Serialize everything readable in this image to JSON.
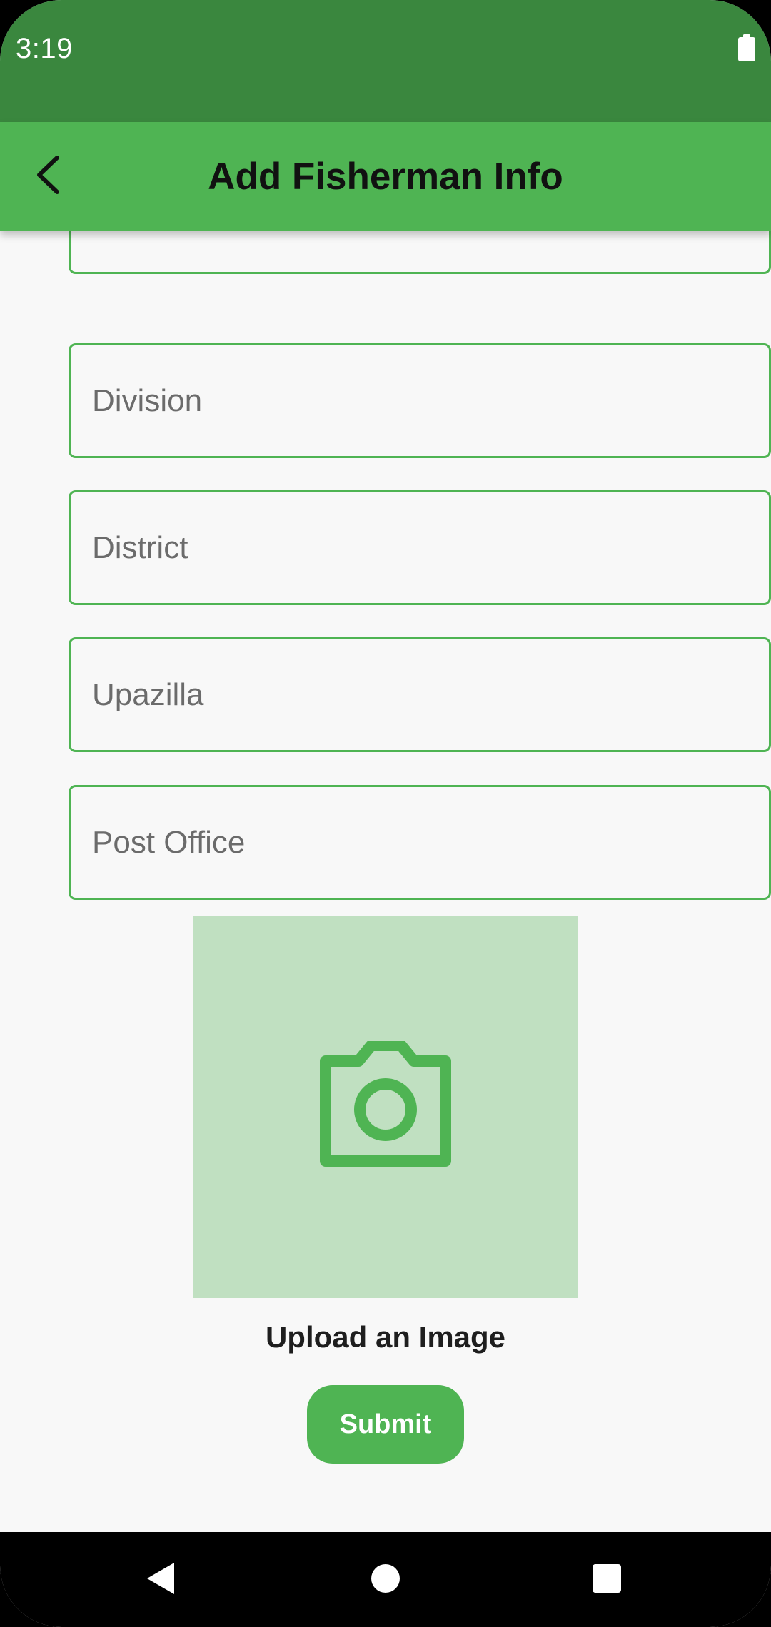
{
  "status_bar": {
    "time": "3:19",
    "battery_icon": "battery-full-icon"
  },
  "app_bar": {
    "title": "Add Fisherman Info",
    "back_icon": "chevron-left-icon",
    "background_color": "#4FB453",
    "status_color": "#3A873E"
  },
  "form": {
    "fields": [
      {
        "placeholder": "",
        "value": ""
      },
      {
        "placeholder": "Division",
        "value": ""
      },
      {
        "placeholder": "District",
        "value": ""
      },
      {
        "placeholder": "Upazilla",
        "value": ""
      },
      {
        "placeholder": "Post Office",
        "value": ""
      }
    ],
    "accent_color": "#4FB453"
  },
  "image_upload": {
    "icon": "camera-icon",
    "label": "Upload an Image",
    "background_color": "#C0E0C1"
  },
  "submit_label": "Submit",
  "nav_bar": {
    "back_icon": "triangle-back-icon",
    "home_icon": "circle-home-icon",
    "recents_icon": "square-recents-icon"
  }
}
